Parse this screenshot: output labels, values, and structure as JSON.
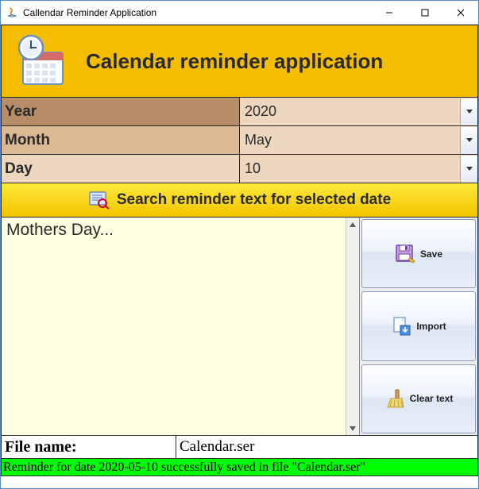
{
  "window": {
    "title": "Callendar Reminder Application"
  },
  "header": {
    "title": "Calendar reminder application"
  },
  "form": {
    "year": {
      "label": "Year",
      "value": "2020"
    },
    "month": {
      "label": "Month",
      "value": "May"
    },
    "day": {
      "label": "Day",
      "value": "10"
    }
  },
  "search": {
    "label": "Search reminder text for selected date"
  },
  "reminder": {
    "text": "Mothers Day..."
  },
  "buttons": {
    "save": "Save",
    "import": "Import",
    "clear": "Clear text"
  },
  "file": {
    "label": "File name:",
    "value": "Calendar.ser"
  },
  "status": {
    "message": "Reminder for date 2020-05-10 successfully saved in file \"Calendar.ser\""
  }
}
